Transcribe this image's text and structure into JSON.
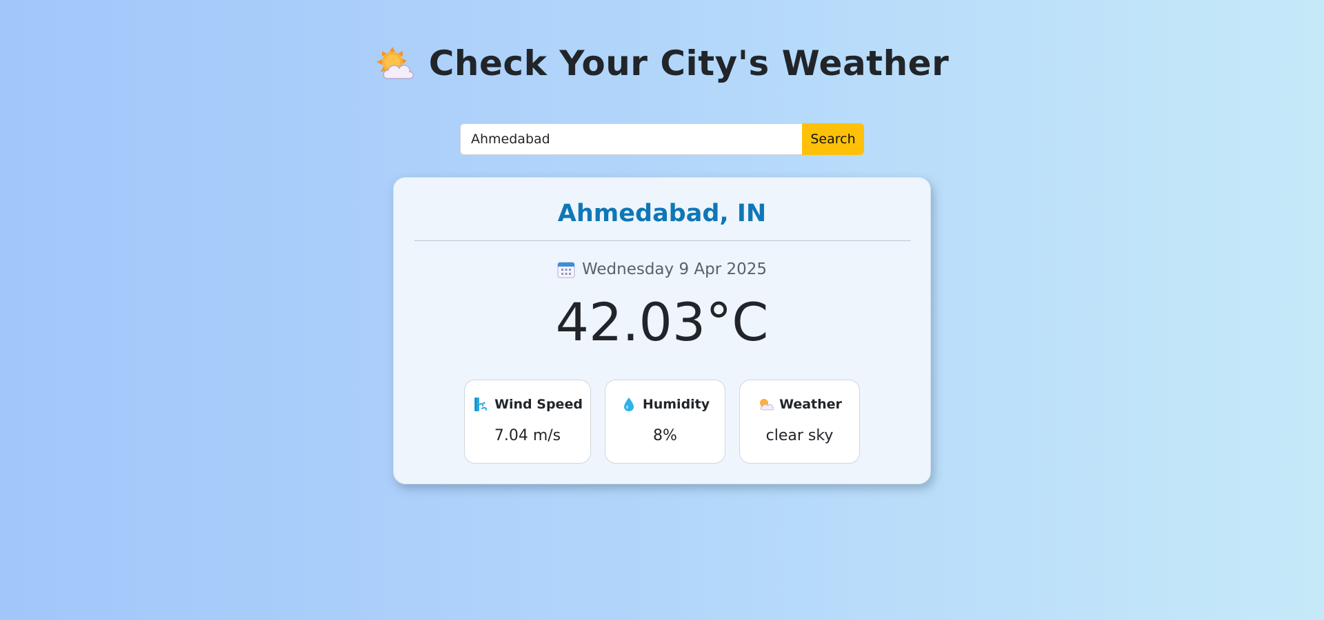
{
  "header": {
    "icon": "sun-behind-cloud-icon",
    "title": "Check Your City's Weather"
  },
  "search": {
    "value": "Ahmedabad",
    "button_label": "Search"
  },
  "weather_card": {
    "city": "Ahmedabad, IN",
    "date_icon": "calendar-icon",
    "date": "Wednesday 9 Apr 2025",
    "temperature": "42.03°C",
    "stats": [
      {
        "icon": "wind-icon",
        "label": "Wind Speed",
        "value": "7.04 m/s"
      },
      {
        "icon": "droplet-icon",
        "label": "Humidity",
        "value": "8%"
      },
      {
        "icon": "sun-behind-cloud-icon",
        "label": "Weather",
        "value": "clear sky"
      }
    ]
  },
  "colors": {
    "accent_city": "#0f77b6",
    "search_button": "#ffc107",
    "card_background": "#eef5fd"
  }
}
